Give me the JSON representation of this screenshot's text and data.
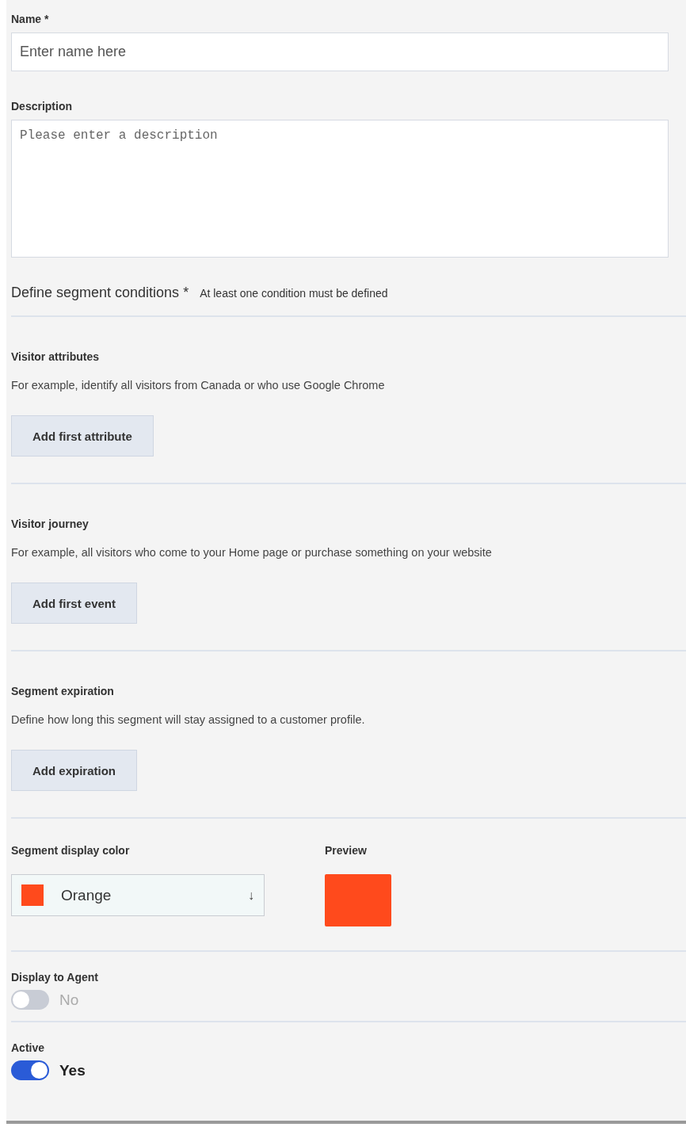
{
  "name_field": {
    "label": "Name *",
    "placeholder": "Enter name here"
  },
  "description_field": {
    "label": "Description",
    "placeholder": "Please enter a description"
  },
  "conditions": {
    "title": "Define segment conditions *",
    "hint": "At least one condition must be defined"
  },
  "sections": [
    {
      "title": "Visitor attributes",
      "text": "For example, identify all visitors from Canada or who use Google Chrome",
      "button": "Add first attribute"
    },
    {
      "title": "Visitor journey",
      "text": "For example, all visitors who come to your Home page or purchase something on your website",
      "button": "Add first event"
    },
    {
      "title": "Segment expiration",
      "text": "Define how long this segment will stay assigned to a customer profile.",
      "button": "Add expiration"
    }
  ],
  "display_color": {
    "label": "Segment display color",
    "value": "Orange",
    "color": "#ff4a1c",
    "arrow": "↓",
    "preview_label": "Preview"
  },
  "toggles": [
    {
      "label": "Display to Agent",
      "on": false,
      "state_text": "No"
    },
    {
      "label": "Active",
      "on": true,
      "state_text": "Yes"
    }
  ]
}
